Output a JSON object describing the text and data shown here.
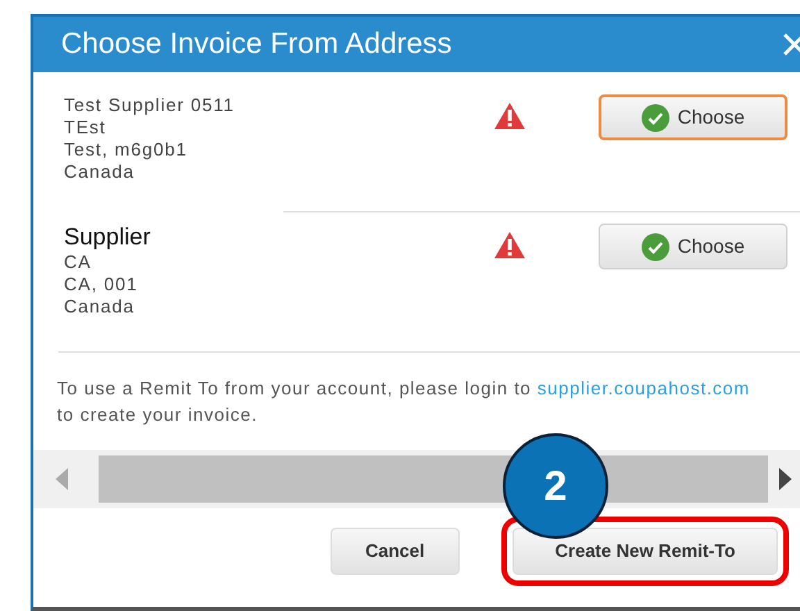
{
  "dialog": {
    "title": "Choose Invoice From Address"
  },
  "addresses": [
    {
      "name": "Test Supplier 0511",
      "lines": [
        "TEst",
        "Test, m6g0b1",
        "Canada"
      ],
      "name_large": false,
      "warning": true,
      "button": "Choose",
      "selected": true
    },
    {
      "name": "Supplier",
      "lines": [
        "CA",
        "CA, 001",
        "Canada"
      ],
      "name_large": true,
      "warning": true,
      "button": "Choose",
      "selected": false
    }
  ],
  "note": {
    "text": "To use a Remit To from your account, please login to",
    "link": "supplier.coupahost.com",
    "text_after": "to create your invoice."
  },
  "footer_buttons": [
    {
      "label": "Cancel",
      "highlighted": false
    },
    {
      "label": "Create New Remit-To",
      "highlighted": true
    }
  ],
  "callout": {
    "label": "2"
  }
}
